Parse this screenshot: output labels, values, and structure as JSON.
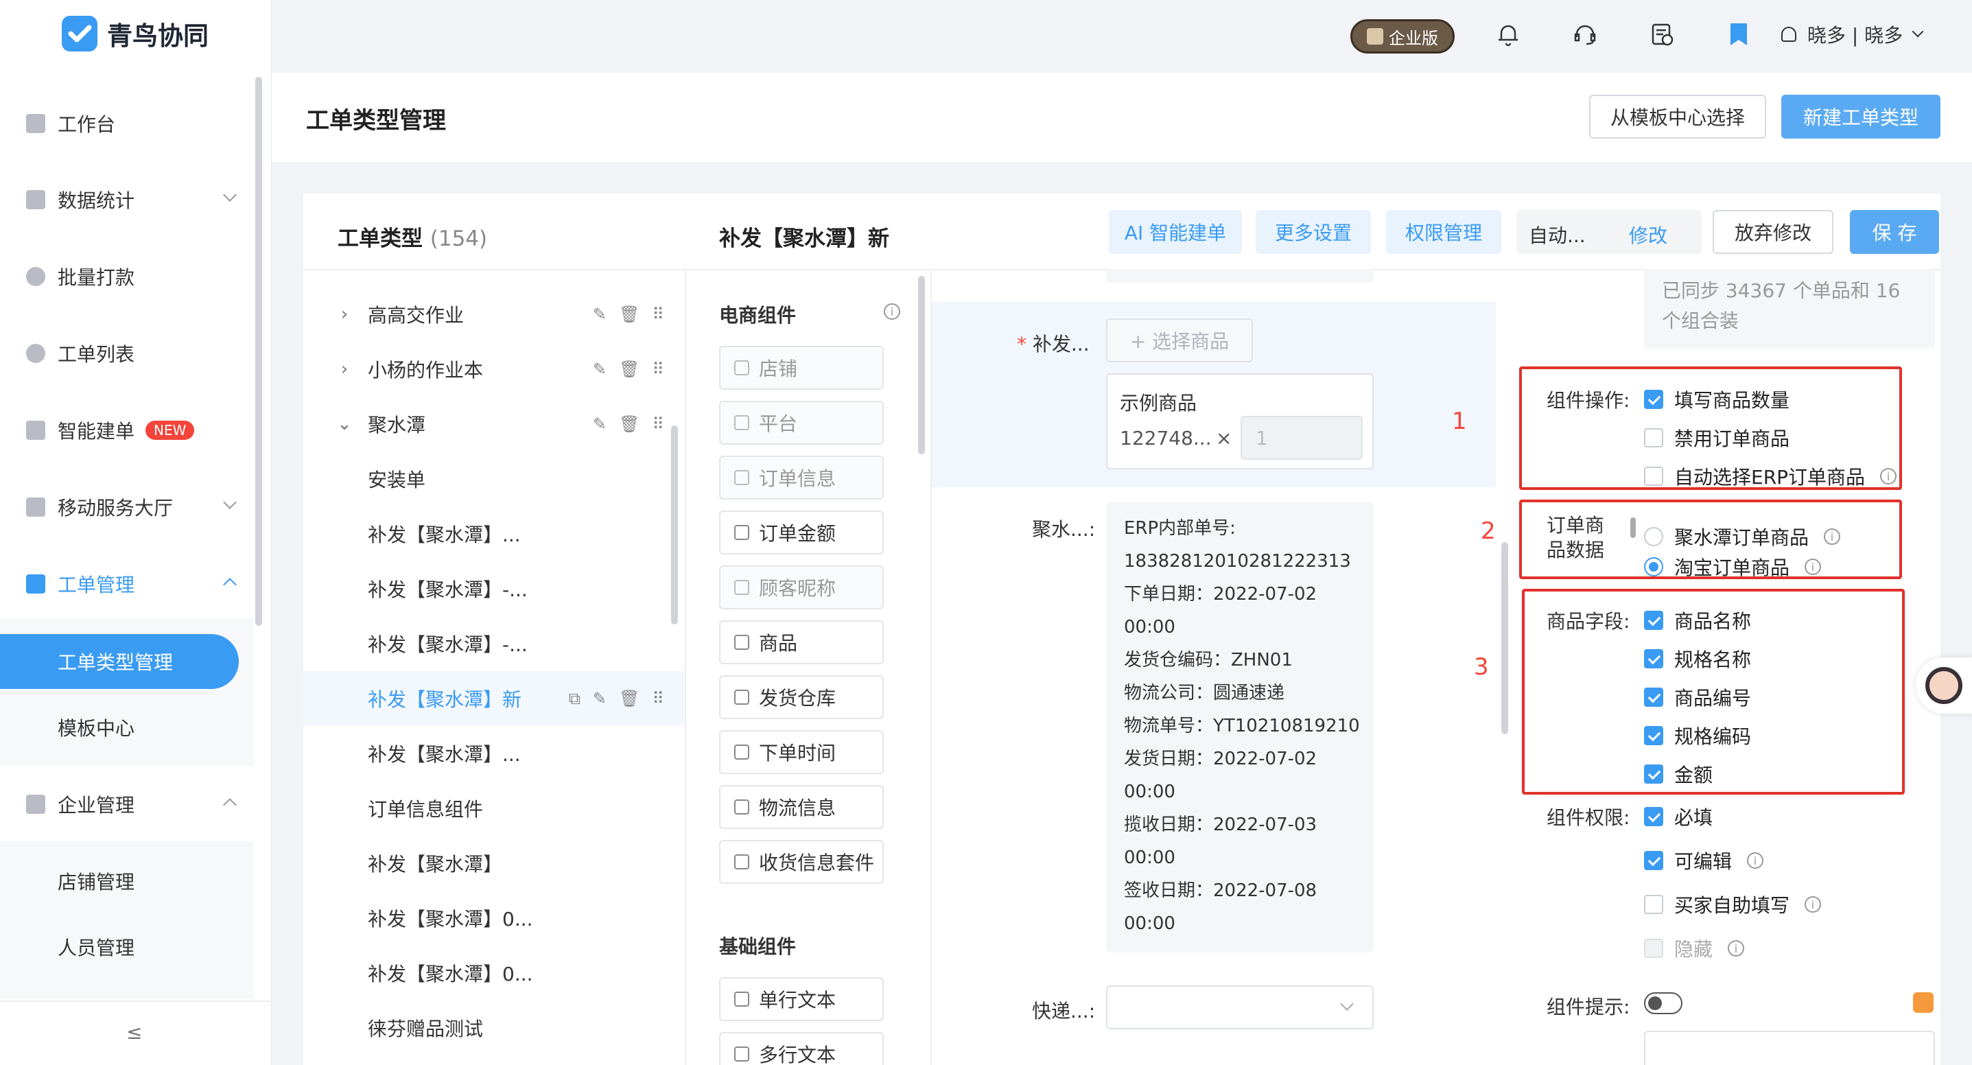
{
  "app": {
    "name": "青鸟协同"
  },
  "sidebar": {
    "items": [
      {
        "label": "工作台"
      },
      {
        "label": "数据统计"
      },
      {
        "label": "批量打款"
      },
      {
        "label": "工单列表"
      },
      {
        "label": "智能建单",
        "badge": "NEW"
      },
      {
        "label": "移动服务大厅"
      },
      {
        "label": "工单管理"
      },
      {
        "label": "企业管理"
      }
    ],
    "workorder_sub": [
      "工单类型管理",
      "模板中心"
    ],
    "enterprise_sub": [
      "店铺管理",
      "人员管理"
    ],
    "collapse_icon": "≤"
  },
  "topbar": {
    "edition": "企业版",
    "user": "晓多 | 晓多"
  },
  "page": {
    "title": "工单类型管理",
    "btn_template": "从模板中心选择",
    "btn_new": "新建工单类型"
  },
  "types": {
    "title": "工单类型",
    "count": "(154)",
    "items": [
      {
        "label": "高高交作业",
        "arrow": "›"
      },
      {
        "label": "小杨的作业本",
        "arrow": "›"
      },
      {
        "label": "聚水潭",
        "arrow": "⌄"
      },
      {
        "label": "安装单"
      },
      {
        "label": "补发【聚水潭】..."
      },
      {
        "label": "补发【聚水潭】-..."
      },
      {
        "label": "补发【聚水潭】-..."
      },
      {
        "label": "补发【聚水潭】新"
      },
      {
        "label": "补发【聚水潭】..."
      },
      {
        "label": "订单信息组件"
      },
      {
        "label": "补发【聚水潭】"
      },
      {
        "label": "补发【聚水潭】0..."
      },
      {
        "label": "补发【聚水潭】0..."
      },
      {
        "label": "徕芬赠品测试"
      }
    ]
  },
  "form": {
    "title": "补发【聚水潭】新",
    "btn_ai": "AI 智能建单",
    "btn_more": "更多设置",
    "btn_perm": "权限管理",
    "auto_text": "自动...",
    "btn_modify": "修改",
    "btn_discard": "放弃修改",
    "btn_save": "保 存"
  },
  "components": {
    "ecommerce_title": "电商组件",
    "ecommerce": [
      "店铺",
      "平台",
      "订单信息",
      "订单金额",
      "顾客昵称",
      "商品",
      "发货仓库",
      "下单时间",
      "物流信息",
      "收货信息套件"
    ],
    "basic_title": "基础组件",
    "basic": [
      "单行文本",
      "多行文本"
    ]
  },
  "canvas": {
    "goods_label": "补发...",
    "select_goods": "+ 选择商品",
    "example_title": "示例商品",
    "example_code": "122748...",
    "times": "×",
    "qty": "1",
    "order_label": "聚水...:",
    "order_lines": [
      "ERP内部单号:",
      "1838281201028122231​3",
      "下单日期：2022-07-02",
      "00:00",
      "发货仓编码：ZHN01",
      "物流公司：圆通速递",
      "物流单号：YT10210819210",
      "发货日期：2022-07-02",
      "00:00",
      "揽收日期：2022-07-03",
      "00:00",
      "签收日期：2022-07-08",
      "00:00"
    ],
    "express_label": "快递...:",
    "marks": [
      "1",
      "2",
      "3"
    ]
  },
  "panel": {
    "sync_text_1": "已同步 34367 个单品和 16",
    "sync_text_2": "个组合装",
    "op_label": "组件操作:",
    "op_options": [
      "填写商品数量",
      "禁用订单商品",
      "自动选择ERP订单商品"
    ],
    "src_label_1": "订单商",
    "src_label_2": "品数据",
    "src_options": [
      "聚水潭订单商品",
      "淘宝订单商品"
    ],
    "field_label": "商品字段:",
    "field_options": [
      "商品名称",
      "规格名称",
      "商品编号",
      "规格编码",
      "金额"
    ],
    "perm_label": "组件权限:",
    "perm_options": [
      "必填",
      "可编辑",
      "买家自助填写",
      "隐藏"
    ],
    "tip_label": "组件提示:"
  },
  "colors": {
    "accent": "#3a9bf2",
    "highlight": "#e0322b"
  }
}
